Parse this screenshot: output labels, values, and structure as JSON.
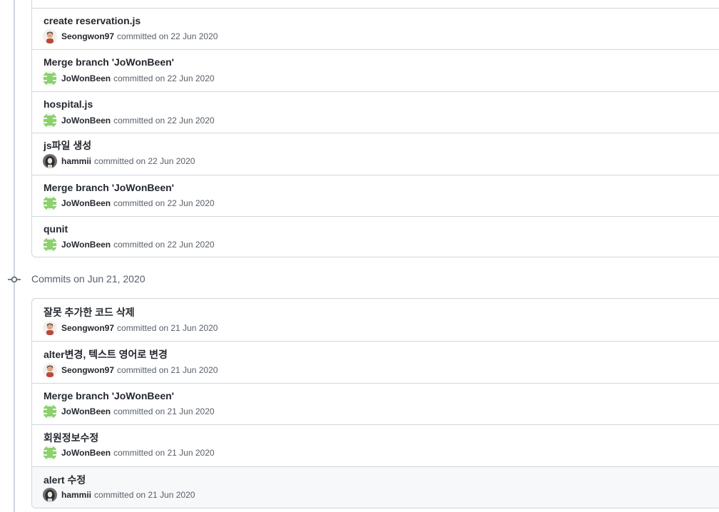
{
  "sections": [
    {
      "header": "",
      "commits": [
        {
          "message": "create reservation.js",
          "author": "Seongwon97",
          "avatar": "photo-avatar",
          "date_text": "committed on 22 Jun 2020"
        },
        {
          "message": "Merge branch 'JoWonBeen'",
          "author": "JoWonBeen",
          "avatar": "identicon-avatar",
          "date_text": "committed on 22 Jun 2020"
        },
        {
          "message": "hospital.js",
          "author": "JoWonBeen",
          "avatar": "identicon-avatar",
          "date_text": "committed on 22 Jun 2020"
        },
        {
          "message": "js파일 생성",
          "author": "hammii",
          "avatar": "portrait-avatar",
          "date_text": "committed on 22 Jun 2020"
        },
        {
          "message": "Merge branch 'JoWonBeen'",
          "author": "JoWonBeen",
          "avatar": "identicon-avatar",
          "date_text": "committed on 22 Jun 2020"
        },
        {
          "message": "qunit",
          "author": "JoWonBeen",
          "avatar": "identicon-avatar",
          "date_text": "committed on 22 Jun 2020"
        }
      ]
    },
    {
      "header": "Commits on Jun 21, 2020",
      "commits": [
        {
          "message": "잘못 추가한 코드 삭제",
          "author": "Seongwon97",
          "avatar": "photo-avatar",
          "date_text": "committed on 21 Jun 2020"
        },
        {
          "message": "alter변경, 텍스트 영어로 변경",
          "author": "Seongwon97",
          "avatar": "photo-avatar",
          "date_text": "committed on 21 Jun 2020"
        },
        {
          "message": "Merge branch 'JoWonBeen'",
          "author": "JoWonBeen",
          "avatar": "identicon-avatar",
          "date_text": "committed on 21 Jun 2020"
        },
        {
          "message": "회원정보수정",
          "author": "JoWonBeen",
          "avatar": "identicon-avatar",
          "date_text": "committed on 21 Jun 2020"
        },
        {
          "message": "alert 수정",
          "author": "hammii",
          "avatar": "portrait-avatar",
          "date_text": "committed on 21 Jun 2020"
        }
      ]
    }
  ],
  "colors": {
    "border": "#d0d7de",
    "text": "#24292f",
    "muted": "#57606a",
    "identicon": "#8cd16e",
    "highlight_row": "#f6f8fa"
  },
  "icons": {
    "timeline_marker": "git-commit-icon"
  }
}
